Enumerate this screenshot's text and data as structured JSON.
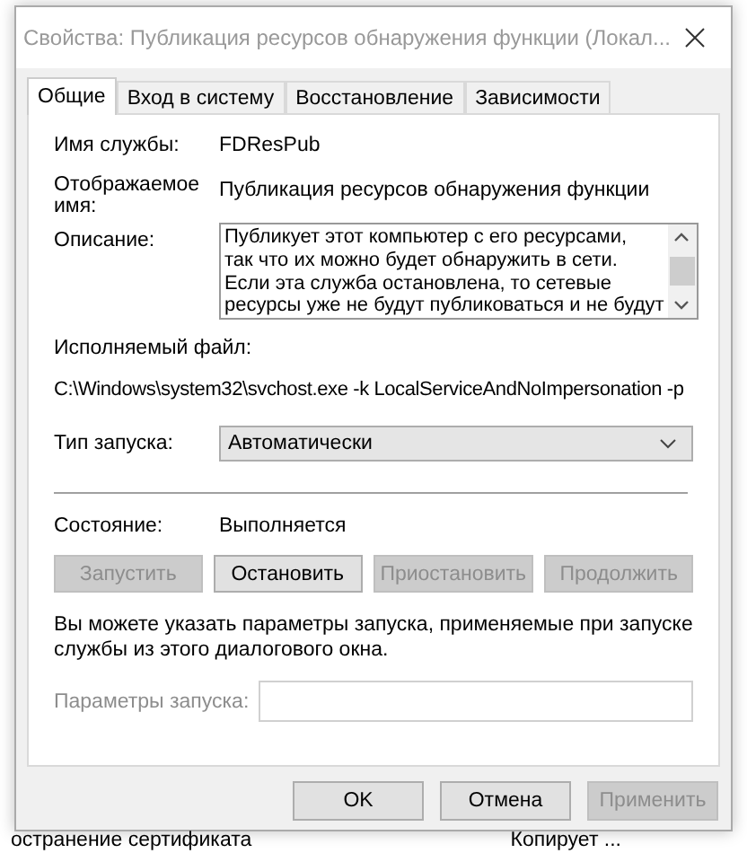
{
  "window": {
    "title": "Свойства: Публикация ресурсов обнаружения функции (Локал..."
  },
  "tabs": [
    {
      "label": "Общие",
      "selected": true
    },
    {
      "label": "Вход в систему",
      "selected": false
    },
    {
      "label": "Восстановление",
      "selected": false
    },
    {
      "label": "Зависимости",
      "selected": false
    }
  ],
  "service_name": {
    "label": "Имя службы:",
    "value": "FDResPub"
  },
  "display_name": {
    "label": "Отображаемое имя:",
    "value": "Публикация ресурсов обнаружения функции"
  },
  "description": {
    "label": "Описание:",
    "lines": [
      "Публикует этот компьютер с его ресурсами,",
      "так что их можно будет обнаружить в сети.",
      "Если эта служба остановлена, то сетевые",
      "ресурсы уже не будут публиковаться и не будут"
    ]
  },
  "executable": {
    "label": "Исполняемый файл:",
    "value": "C:\\Windows\\system32\\svchost.exe -k LocalServiceAndNoImpersonation -p"
  },
  "startup_type": {
    "label": "Тип запуска:",
    "value": "Автоматически"
  },
  "status": {
    "label": "Состояние:",
    "value": "Выполняется"
  },
  "service_buttons": [
    {
      "label": "Запустить",
      "disabled": true
    },
    {
      "label": "Остановить",
      "disabled": false
    },
    {
      "label": "Приостановить",
      "disabled": true
    },
    {
      "label": "Продолжить",
      "disabled": true
    }
  ],
  "hint": "Вы можете указать параметры запуска, применяемые при запуске службы из этого диалогового окна.",
  "start_params": {
    "label": "Параметры запуска:",
    "disabled": true
  },
  "dialog_buttons": [
    {
      "label": "OK",
      "disabled": false
    },
    {
      "label": "Отмена",
      "disabled": false
    },
    {
      "label": "Применить",
      "disabled": true
    }
  ],
  "background_texts": [
    "остранение сертификата",
    "Копирует ..."
  ]
}
